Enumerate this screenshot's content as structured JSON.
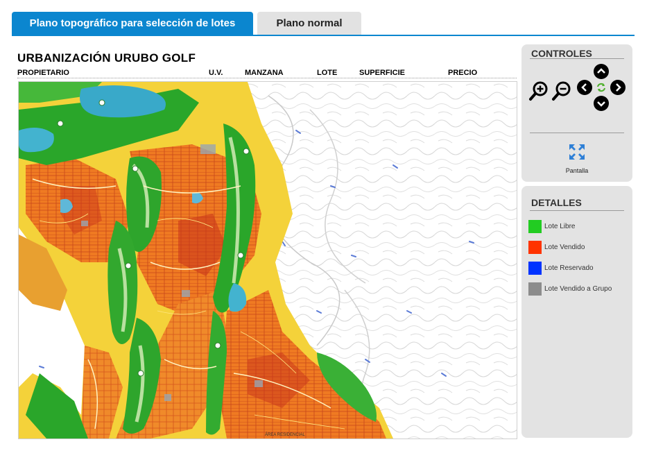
{
  "tabs": [
    {
      "label": "Plano topográfico para selección de lotes",
      "active": true
    },
    {
      "label": "Plano normal",
      "active": false
    }
  ],
  "title": "URBANIZACIÓN URUBO GOLF",
  "infobar": {
    "propietario": "PROPIETARIO",
    "uv": "U.V.",
    "manzana": "MANZANA",
    "lote": "LOTE",
    "superficie": "SUPERFICIE",
    "precio": "PRECIO"
  },
  "map": {
    "footer_text": "ÁREA RESIDENCIAL"
  },
  "controls": {
    "title": "CONTROLES",
    "zoom_in_icon": "zoom-in-icon",
    "zoom_out_icon": "zoom-out-icon",
    "pan_icons": [
      "arrow-up-icon",
      "arrow-left-icon",
      "reset-icon",
      "arrow-right-icon",
      "arrow-down-icon"
    ],
    "fullscreen_label": "Pantalla"
  },
  "details": {
    "title": "DETALLES",
    "legend": [
      {
        "label": "Lote Libre",
        "color": "#22cc22"
      },
      {
        "label": "Lote Vendido",
        "color": "#ff3300"
      },
      {
        "label": "Lote Reservado",
        "color": "#0033ff"
      },
      {
        "label": "Lote Vendido a Grupo",
        "color": "#8c8c8c"
      }
    ]
  },
  "colors": {
    "accent": "#0b86cf",
    "panel": "#e3e3e3"
  }
}
